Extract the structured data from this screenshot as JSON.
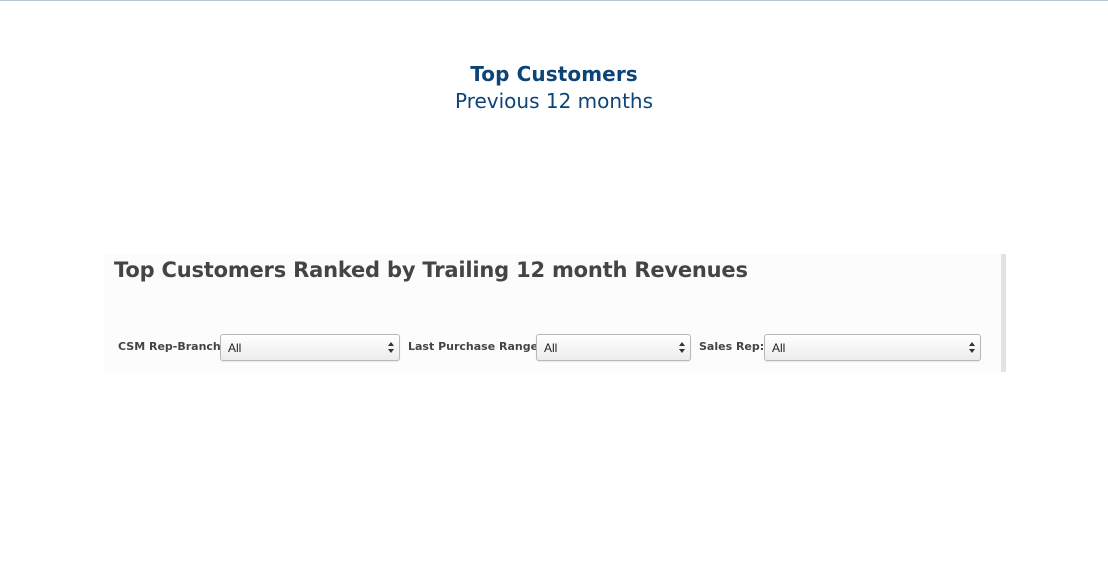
{
  "header": {
    "title": "Top Customers",
    "subtitle": "Previous 12 months"
  },
  "panel": {
    "title": "Top Customers Ranked by Trailing 12 month Revenues",
    "filters": [
      {
        "label": "CSM Rep-Branch:",
        "value": "All"
      },
      {
        "label": "Last Purchase Range:",
        "value": "All"
      },
      {
        "label": "Sales Rep:",
        "value": "All"
      }
    ]
  },
  "colors": {
    "header_text": "#0d4477",
    "panel_title": "#444444",
    "panel_background": "#fcfcfc"
  },
  "icons": {
    "select_arrows": "up-down-arrows-icon"
  }
}
